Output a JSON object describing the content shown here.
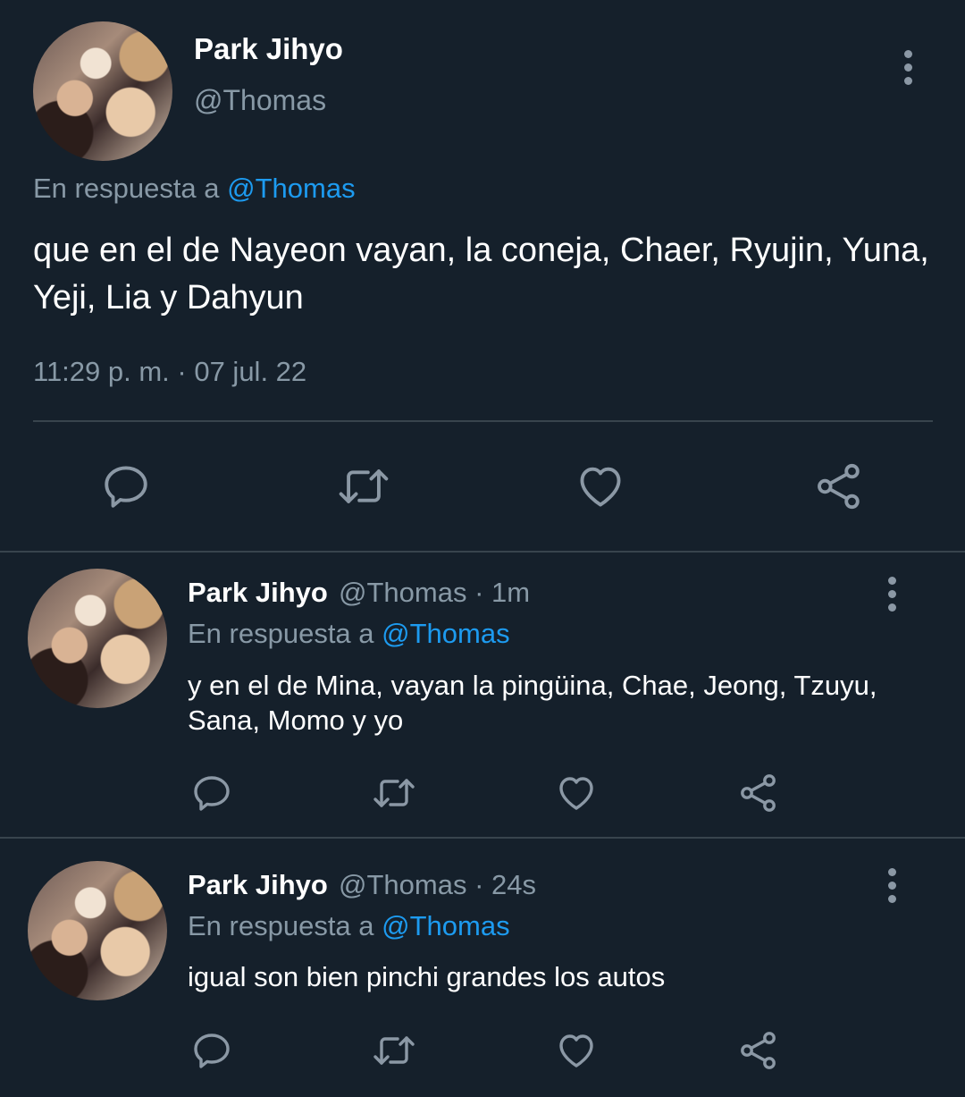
{
  "main_tweet": {
    "name": "Park Jihyo",
    "handle": "@Thomas",
    "reply_prefix": "En respuesta a",
    "reply_to": "@Thomas",
    "text": "que en el de Nayeon vayan, la coneja, Chaer, Ryujin, Yuna, Yeji, Lia y Dahyun",
    "timestamp": "11:29 p. m. · 07 jul. 22",
    "actions": [
      "reply-icon",
      "retweet-icon",
      "like-icon",
      "share-icon"
    ]
  },
  "replies": [
    {
      "name": "Park Jihyo",
      "handle": "@Thomas",
      "time": "· 1m",
      "reply_prefix": "En respuesta a",
      "reply_to": "@Thomas",
      "text": "y en el de Mina, vayan la pingüina, Chae, Jeong, Tzuyu, Sana, Momo y yo"
    },
    {
      "name": "Park Jihyo",
      "handle": "@Thomas",
      "time": "· 24s",
      "reply_prefix": "En respuesta a",
      "reply_to": "@Thomas",
      "text": "igual son bien pinchi grandes los autos"
    }
  ],
  "colors": {
    "background": "#15202b",
    "secondary_text": "#8899a6",
    "mention": "#1d9bf0",
    "divider": "#38444d"
  }
}
